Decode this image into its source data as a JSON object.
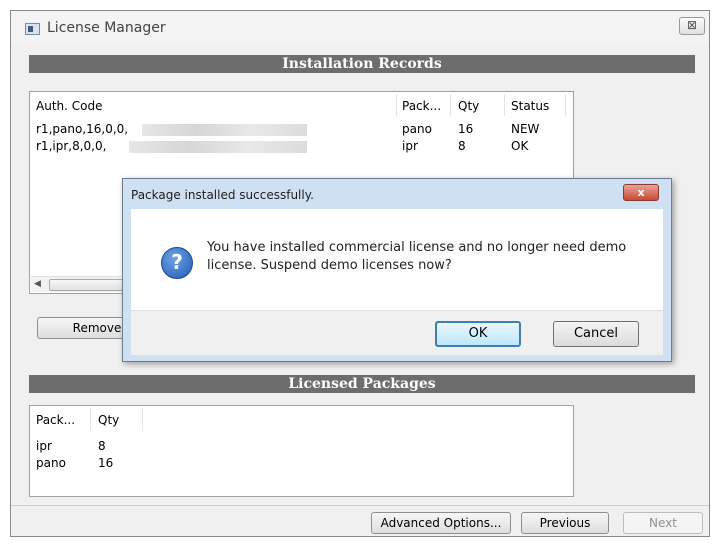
{
  "window": {
    "title": "License Manager",
    "close_glyph": "⊠"
  },
  "installation": {
    "header": "Installation Records",
    "columns": [
      "Auth. Code",
      "Pack...",
      "Qty",
      "Status"
    ],
    "rows": [
      {
        "auth": "r1,pano,16,0,0,",
        "pack": "pano",
        "qty": "16",
        "status": "NEW"
      },
      {
        "auth": "r1,ipr,8,0,0,",
        "pack": "ipr",
        "qty": "8",
        "status": "OK"
      }
    ],
    "remove_label": "Remove"
  },
  "licensed": {
    "header": "Licensed Packages",
    "columns": [
      "Pack...",
      "Qty"
    ],
    "rows": [
      {
        "pack": "ipr",
        "qty": "8"
      },
      {
        "pack": "pano",
        "qty": "16"
      }
    ]
  },
  "footer": {
    "advanced_label": "Advanced Options...",
    "previous_label": "Previous",
    "next_label": "Next"
  },
  "dialog": {
    "title": "Package installed successfully.",
    "close_glyph": "x",
    "icon": "question-icon",
    "icon_glyph": "?",
    "message": "You have installed commercial license and no longer need demo license. Suspend demo licenses now?",
    "ok_label": "OK",
    "cancel_label": "Cancel"
  }
}
